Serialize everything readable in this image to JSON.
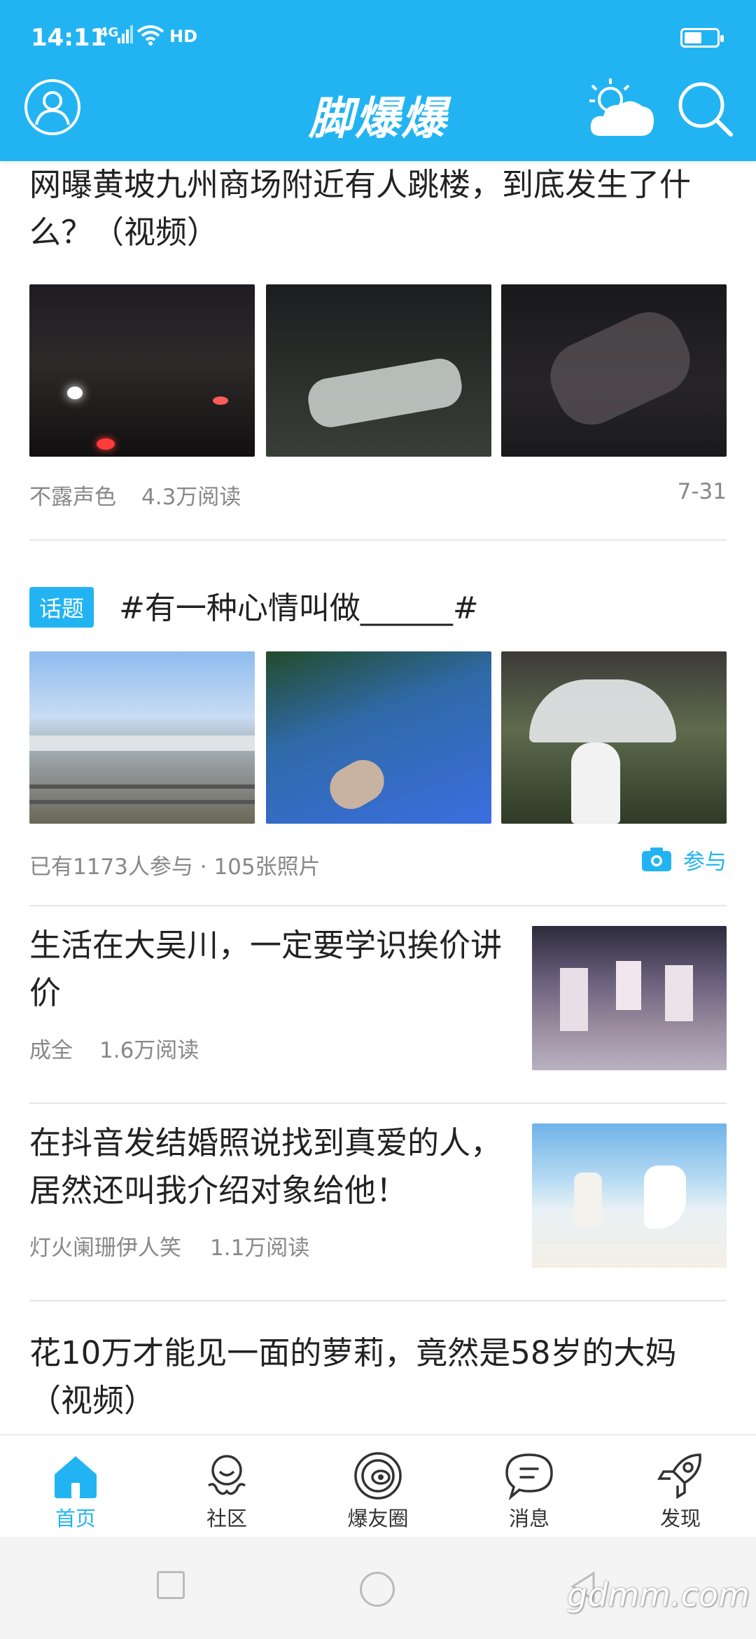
{
  "status_bar": {
    "time": "14:11",
    "network": "4G",
    "hd": "HD"
  },
  "header": {
    "logo": "脚爆爆"
  },
  "feed": {
    "article1": {
      "title": "网曝黄坡九州商场附近有人跳楼，到底发生了什么？（视频）",
      "author": "不露声色",
      "reads": "4.3万阅读",
      "date": "7-31"
    },
    "topic": {
      "badge": "话题",
      "title": "#有一种心情叫做______#",
      "stats": "已有1173人参与 · 105张照片",
      "join_label": "参与"
    },
    "article2": {
      "title": "生活在大吴川，一定要学识挨价讲价",
      "author": "成全",
      "reads": "1.6万阅读"
    },
    "article3": {
      "title": "在抖音发结婚照说找到真爱的人，居然还叫我介绍对象给他！",
      "author": "灯火阑珊伊人笑",
      "reads": "1.1万阅读"
    },
    "article4": {
      "title": "花10万才能见一面的萝莉，竟然是58岁的大妈（视频）"
    }
  },
  "tabs": [
    {
      "label": "首页",
      "icon": "home-icon",
      "active": true
    },
    {
      "label": "社区",
      "icon": "community-icon",
      "active": false
    },
    {
      "label": "爆友圈",
      "icon": "planet-icon",
      "active": false
    },
    {
      "label": "消息",
      "icon": "message-icon",
      "active": false
    },
    {
      "label": "发现",
      "icon": "rocket-icon",
      "active": false
    }
  ],
  "watermark": "gdmm.com",
  "colors": {
    "accent": "#22b4f2",
    "meta_text": "#888888"
  }
}
